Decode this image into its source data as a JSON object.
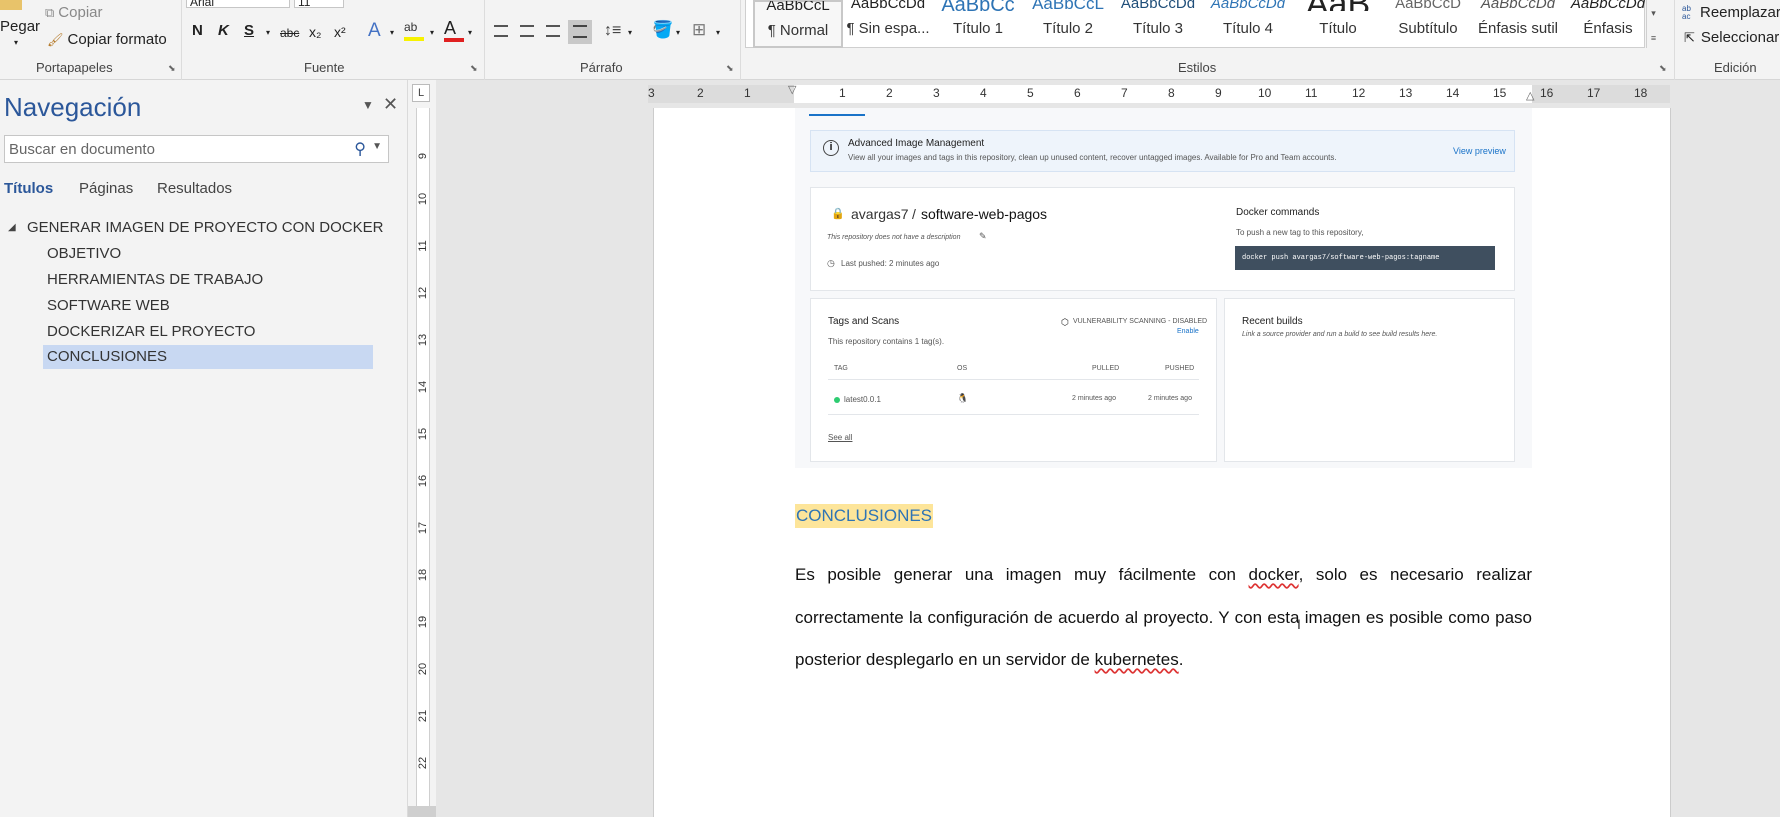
{
  "ribbon": {
    "clipboard": {
      "paste": "Pegar",
      "copy": "Copiar",
      "format_painter": "Copiar formato",
      "label": "Portapapeles"
    },
    "font": {
      "name": "Arial",
      "size": "11",
      "label": "Fuente",
      "bold": "N",
      "italic": "K",
      "underline": "S",
      "strike": "abc",
      "sub": "x₂",
      "sup": "x²"
    },
    "paragraph": {
      "label": "Párrafo"
    },
    "styles": {
      "label": "Estilos",
      "items": [
        {
          "preview": "AaBbCcL",
          "name": "¶ Normal"
        },
        {
          "preview": "AaBbCcDd",
          "name": "¶ Sin espa..."
        },
        {
          "preview": "AaBbCc",
          "name": "Título 1"
        },
        {
          "preview": "AaBbCcL",
          "name": "Título 2"
        },
        {
          "preview": "AaBbCcDd",
          "name": "Título 3"
        },
        {
          "preview": "AaBbCcDd",
          "name": "Título 4"
        },
        {
          "preview": "AaB",
          "name": "Título"
        },
        {
          "preview": "AaBbCcD",
          "name": "Subtítulo"
        },
        {
          "preview": "AaBbCcDd",
          "name": "Énfasis sutil"
        },
        {
          "preview": "AaBbCcDd",
          "name": "Énfasis"
        }
      ]
    },
    "editing": {
      "label": "Edición",
      "replace": "Reemplazar",
      "select": "Seleccionar",
      "replace_icon": "ab ac"
    }
  },
  "nav": {
    "title": "Navegación",
    "search_placeholder": "Buscar en documento",
    "tabs": [
      "Títulos",
      "Páginas",
      "Resultados"
    ],
    "headings": [
      {
        "label": "GENERAR IMAGEN DE PROYECTO CON DOCKER",
        "level": 1
      },
      {
        "label": "OBJETIVO",
        "level": 2
      },
      {
        "label": "HERRAMIENTAS DE TRABAJO",
        "level": 2
      },
      {
        "label": "SOFTWARE WEB",
        "level": 2
      },
      {
        "label": "DOCKERIZAR EL PROYECTO",
        "level": 2
      },
      {
        "label": "CONCLUSIONES",
        "level": 2,
        "selected": true
      }
    ]
  },
  "ruler": {
    "h_ticks": [
      "3",
      "2",
      "1",
      "1",
      "2",
      "3",
      "4",
      "5",
      "6",
      "7",
      "8",
      "9",
      "10",
      "11",
      "12",
      "13",
      "14",
      "15",
      "16",
      "17",
      "18"
    ],
    "v_ticks": [
      "9",
      "10",
      "11",
      "12",
      "13",
      "14",
      "15",
      "16",
      "17",
      "18",
      "19",
      "20",
      "21",
      "22"
    ],
    "tab_marker": "L"
  },
  "screenshot": {
    "banner_title": "Advanced Image Management",
    "banner_text": "View all your images and tags in this repository, clean up unused content, recover untagged images. Available for Pro and Team accounts.",
    "banner_link": "View preview",
    "repo_owner": "avargas7",
    "repo_name": "software-web-pagos",
    "repo_desc": "This repository does not have a description",
    "last_pushed": "Last pushed: 2 minutes ago",
    "docker_title": "Docker commands",
    "docker_sub": "To push a new tag to this repository,",
    "docker_cmd": "docker push avargas7/software-web-pagos:tagname",
    "tags_title": "Tags and Scans",
    "tags_sub": "This repository contains 1 tag(s).",
    "vuln": "VULNERABILITY SCANNING - DISABLED",
    "enable": "Enable",
    "col_tag": "TAG",
    "col_os": "OS",
    "col_pulled": "PULLED",
    "col_pushed": "PUSHED",
    "row_tag": "latest0.0.1",
    "row_pulled": "2 minutes ago",
    "row_pushed": "2 minutes ago",
    "see_all": "See all",
    "builds_title": "Recent builds",
    "builds_text": "Link a source provider and run a build to see build results here."
  },
  "doc": {
    "heading": "CONCLUSIONES",
    "para_1": "Es posible generar una imagen muy fácilmente con ",
    "para_word_1": "docker",
    "para_2": ", solo es necesario realizar correctamente la configuración de acuerdo al proyecto. Y con esta imagen es posible como paso posterior desplegarlo en un servidor de ",
    "para_word_2": "kubernetes",
    "para_3": "."
  },
  "colors": {
    "accent": "#2b579a",
    "heading_highlight": "#fde59a",
    "heading_text": "#2e74b5",
    "nav_selected": "#c8d8f2"
  }
}
